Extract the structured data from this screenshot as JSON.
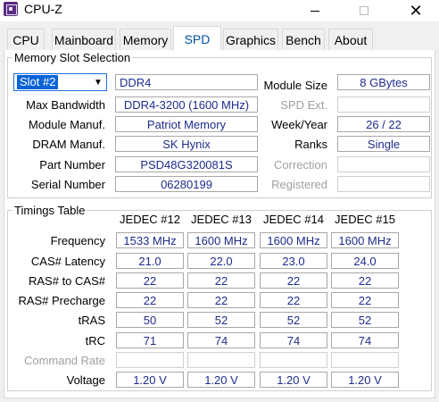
{
  "window": {
    "title": "CPU-Z"
  },
  "tabs": [
    {
      "label": "CPU"
    },
    {
      "label": "Mainboard"
    },
    {
      "label": "Memory"
    },
    {
      "label": "SPD"
    },
    {
      "label": "Graphics"
    },
    {
      "label": "Bench"
    },
    {
      "label": "About"
    }
  ],
  "active_tab": "SPD",
  "memory_slot": {
    "group_title": "Memory Slot Selection",
    "slot_selected": "Slot #2",
    "memory_type": "DDR4",
    "labels": {
      "max_bandwidth": "Max Bandwidth",
      "module_manuf": "Module Manuf.",
      "dram_manuf": "DRAM Manuf.",
      "part_number": "Part Number",
      "serial_number": "Serial Number",
      "module_size": "Module Size",
      "spd_ext": "SPD Ext.",
      "week_year": "Week/Year",
      "ranks": "Ranks",
      "correction": "Correction",
      "registered": "Registered"
    },
    "values": {
      "max_bandwidth": "DDR4-3200 (1600 MHz)",
      "module_manuf": "Patriot Memory",
      "dram_manuf": "SK Hynix",
      "part_number": "PSD48G320081S",
      "serial_number": "06280199",
      "module_size": "8 GBytes",
      "spd_ext": "",
      "week_year": "26 / 22",
      "ranks": "Single",
      "correction": "",
      "registered": ""
    }
  },
  "timings": {
    "group_title": "Timings Table",
    "columns": [
      "JEDEC #12",
      "JEDEC #13",
      "JEDEC #14",
      "JEDEC #15"
    ],
    "rows": [
      {
        "label": "Frequency",
        "values": [
          "1533 MHz",
          "1600 MHz",
          "1600 MHz",
          "1600 MHz"
        ]
      },
      {
        "label": "CAS# Latency",
        "values": [
          "21.0",
          "22.0",
          "23.0",
          "24.0"
        ]
      },
      {
        "label": "RAS# to CAS#",
        "values": [
          "22",
          "22",
          "22",
          "22"
        ]
      },
      {
        "label": "RAS# Precharge",
        "values": [
          "22",
          "22",
          "22",
          "22"
        ]
      },
      {
        "label": "tRAS",
        "values": [
          "50",
          "52",
          "52",
          "52"
        ]
      },
      {
        "label": "tRC",
        "values": [
          "71",
          "74",
          "74",
          "74"
        ]
      },
      {
        "label": "Command Rate",
        "values": [
          "",
          "",
          "",
          ""
        ],
        "disabled": true
      },
      {
        "label": "Voltage",
        "values": [
          "1.20 V",
          "1.20 V",
          "1.20 V",
          "1.20 V"
        ]
      }
    ]
  }
}
